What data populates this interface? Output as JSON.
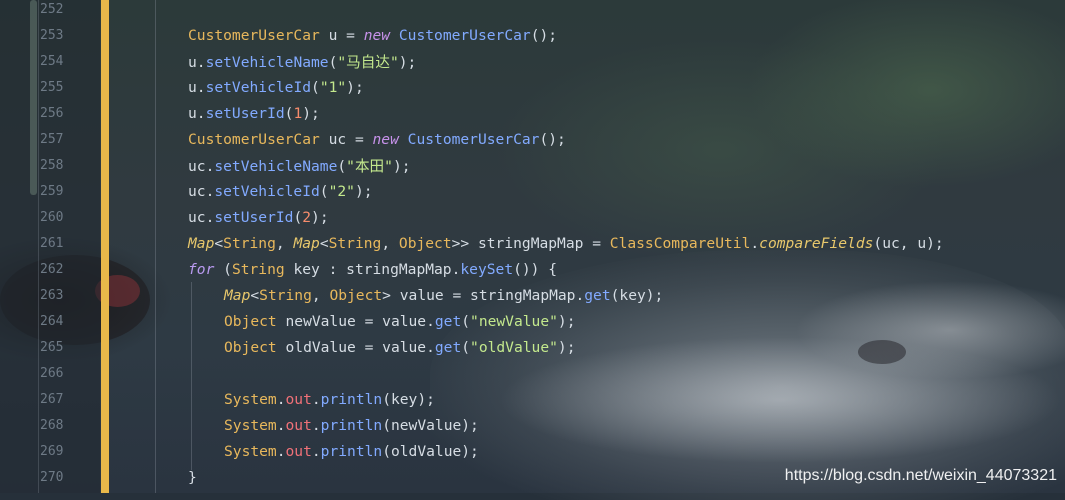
{
  "editor": {
    "lines": [
      {
        "no": "252",
        "indent": 0,
        "tokens": []
      },
      {
        "no": "253",
        "indent": 0,
        "tokens": [
          {
            "t": "CustomerUserCar",
            "c": "cls"
          },
          {
            "t": " u = ",
            "c": "plain"
          },
          {
            "t": "new",
            "c": "kw"
          },
          {
            "t": " ",
            "c": "plain"
          },
          {
            "t": "CustomerUserCar",
            "c": "method"
          },
          {
            "t": "();",
            "c": "plain"
          }
        ]
      },
      {
        "no": "254",
        "indent": 0,
        "tokens": [
          {
            "t": "u.",
            "c": "plain"
          },
          {
            "t": "setVehicleName",
            "c": "method"
          },
          {
            "t": "(",
            "c": "plain"
          },
          {
            "t": "\"马自达\"",
            "c": "str"
          },
          {
            "t": ");",
            "c": "plain"
          }
        ]
      },
      {
        "no": "255",
        "indent": 0,
        "tokens": [
          {
            "t": "u.",
            "c": "plain"
          },
          {
            "t": "setVehicleId",
            "c": "method"
          },
          {
            "t": "(",
            "c": "plain"
          },
          {
            "t": "\"1\"",
            "c": "str"
          },
          {
            "t": ");",
            "c": "plain"
          }
        ]
      },
      {
        "no": "256",
        "indent": 0,
        "tokens": [
          {
            "t": "u.",
            "c": "plain"
          },
          {
            "t": "setUserId",
            "c": "method"
          },
          {
            "t": "(",
            "c": "plain"
          },
          {
            "t": "1",
            "c": "num"
          },
          {
            "t": ");",
            "c": "plain"
          }
        ]
      },
      {
        "no": "257",
        "indent": 0,
        "tokens": [
          {
            "t": "CustomerUserCar",
            "c": "cls"
          },
          {
            "t": " uc = ",
            "c": "plain"
          },
          {
            "t": "new",
            "c": "kw"
          },
          {
            "t": " ",
            "c": "plain"
          },
          {
            "t": "CustomerUserCar",
            "c": "method"
          },
          {
            "t": "();",
            "c": "plain"
          }
        ]
      },
      {
        "no": "258",
        "indent": 0,
        "tokens": [
          {
            "t": "uc.",
            "c": "plain"
          },
          {
            "t": "setVehicleName",
            "c": "method"
          },
          {
            "t": "(",
            "c": "plain"
          },
          {
            "t": "\"本田\"",
            "c": "str"
          },
          {
            "t": ");",
            "c": "plain"
          }
        ]
      },
      {
        "no": "259",
        "indent": 0,
        "tokens": [
          {
            "t": "uc.",
            "c": "plain"
          },
          {
            "t": "setVehicleId",
            "c": "method"
          },
          {
            "t": "(",
            "c": "plain"
          },
          {
            "t": "\"2\"",
            "c": "str"
          },
          {
            "t": ");",
            "c": "plain"
          }
        ]
      },
      {
        "no": "260",
        "indent": 0,
        "tokens": [
          {
            "t": "uc.",
            "c": "plain"
          },
          {
            "t": "setUserId",
            "c": "method"
          },
          {
            "t": "(",
            "c": "plain"
          },
          {
            "t": "2",
            "c": "num"
          },
          {
            "t": ");",
            "c": "plain"
          }
        ]
      },
      {
        "no": "261",
        "indent": 0,
        "tokens": [
          {
            "t": "Map",
            "c": "itype"
          },
          {
            "t": "<",
            "c": "plain"
          },
          {
            "t": "String",
            "c": "type"
          },
          {
            "t": ", ",
            "c": "plain"
          },
          {
            "t": "Map",
            "c": "itype"
          },
          {
            "t": "<",
            "c": "plain"
          },
          {
            "t": "String",
            "c": "type"
          },
          {
            "t": ", ",
            "c": "plain"
          },
          {
            "t": "Object",
            "c": "type"
          },
          {
            "t": ">> stringMapMap = ",
            "c": "plain"
          },
          {
            "t": "ClassCompareUtil",
            "c": "cls"
          },
          {
            "t": ".",
            "c": "plain"
          },
          {
            "t": "compareFields",
            "c": "imeth"
          },
          {
            "t": "(uc, u);",
            "c": "plain"
          }
        ]
      },
      {
        "no": "262",
        "indent": 0,
        "tokens": [
          {
            "t": "for",
            "c": "kwp"
          },
          {
            "t": " (",
            "c": "plain"
          },
          {
            "t": "String",
            "c": "type"
          },
          {
            "t": " key : stringMapMap.",
            "c": "plain"
          },
          {
            "t": "keySet",
            "c": "method"
          },
          {
            "t": "()) {",
            "c": "plain"
          }
        ]
      },
      {
        "no": "263",
        "indent": 1,
        "tokens": [
          {
            "t": "Map",
            "c": "itype"
          },
          {
            "t": "<",
            "c": "plain"
          },
          {
            "t": "String",
            "c": "type"
          },
          {
            "t": ", ",
            "c": "plain"
          },
          {
            "t": "Object",
            "c": "type"
          },
          {
            "t": "> value = stringMapMap.",
            "c": "plain"
          },
          {
            "t": "get",
            "c": "method"
          },
          {
            "t": "(key);",
            "c": "plain"
          }
        ]
      },
      {
        "no": "264",
        "indent": 1,
        "tokens": [
          {
            "t": "Object",
            "c": "type"
          },
          {
            "t": " newValue = value.",
            "c": "plain"
          },
          {
            "t": "get",
            "c": "method"
          },
          {
            "t": "(",
            "c": "plain"
          },
          {
            "t": "\"newValue\"",
            "c": "str"
          },
          {
            "t": ");",
            "c": "plain"
          }
        ]
      },
      {
        "no": "265",
        "indent": 1,
        "tokens": [
          {
            "t": "Object",
            "c": "type"
          },
          {
            "t": " oldValue = value.",
            "c": "plain"
          },
          {
            "t": "get",
            "c": "method"
          },
          {
            "t": "(",
            "c": "plain"
          },
          {
            "t": "\"oldValue\"",
            "c": "str"
          },
          {
            "t": ");",
            "c": "plain"
          }
        ]
      },
      {
        "no": "266",
        "indent": 1,
        "tokens": []
      },
      {
        "no": "267",
        "indent": 1,
        "tokens": [
          {
            "t": "System",
            "c": "type"
          },
          {
            "t": ".",
            "c": "plain"
          },
          {
            "t": "out",
            "c": "field"
          },
          {
            "t": ".",
            "c": "plain"
          },
          {
            "t": "println",
            "c": "method"
          },
          {
            "t": "(key);",
            "c": "plain"
          }
        ]
      },
      {
        "no": "268",
        "indent": 1,
        "tokens": [
          {
            "t": "System",
            "c": "type"
          },
          {
            "t": ".",
            "c": "plain"
          },
          {
            "t": "out",
            "c": "field"
          },
          {
            "t": ".",
            "c": "plain"
          },
          {
            "t": "println",
            "c": "method"
          },
          {
            "t": "(newValue);",
            "c": "plain"
          }
        ]
      },
      {
        "no": "269",
        "indent": 1,
        "tokens": [
          {
            "t": "System",
            "c": "type"
          },
          {
            "t": ".",
            "c": "plain"
          },
          {
            "t": "out",
            "c": "field"
          },
          {
            "t": ".",
            "c": "plain"
          },
          {
            "t": "println",
            "c": "method"
          },
          {
            "t": "(oldValue);",
            "c": "plain"
          }
        ]
      },
      {
        "no": "270",
        "indent": 0,
        "tokens": [
          {
            "t": "}",
            "c": "plain"
          }
        ]
      }
    ]
  },
  "colors": {
    "change_bar": "#e8b84a",
    "class_name": "#e8b85c",
    "keyword": "#c792ea",
    "method": "#82aaff",
    "string": "#c3e88d",
    "number": "#f78c6c",
    "field": "#f07178"
  },
  "watermark": "https://blog.csdn.net/weixin_44073321"
}
